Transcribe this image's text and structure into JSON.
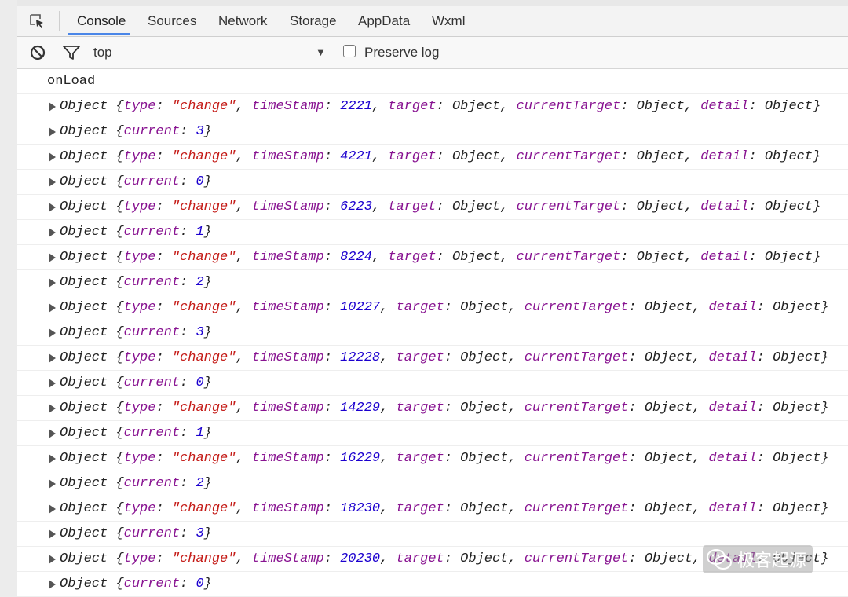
{
  "tabs": [
    "Console",
    "Sources",
    "Network",
    "Storage",
    "AppData",
    "Wxml"
  ],
  "toolbar": {
    "context": "top",
    "dropdown_arrow": "▼",
    "preserve_log": "Preserve log"
  },
  "log": {
    "first": "onLoad",
    "event_prefix": "Object {",
    "current_prefix": "Object {",
    "entries": [
      {
        "kind": "event",
        "timeStamp": "2221"
      },
      {
        "kind": "current",
        "current": "3"
      },
      {
        "kind": "event",
        "timeStamp": "4221"
      },
      {
        "kind": "current",
        "current": "0"
      },
      {
        "kind": "event",
        "timeStamp": "6223"
      },
      {
        "kind": "current",
        "current": "1"
      },
      {
        "kind": "event",
        "timeStamp": "8224"
      },
      {
        "kind": "current",
        "current": "2"
      },
      {
        "kind": "event",
        "timeStamp": "10227"
      },
      {
        "kind": "current",
        "current": "3"
      },
      {
        "kind": "event",
        "timeStamp": "12228"
      },
      {
        "kind": "current",
        "current": "0"
      },
      {
        "kind": "event",
        "timeStamp": "14229"
      },
      {
        "kind": "current",
        "current": "1"
      },
      {
        "kind": "event",
        "timeStamp": "16229"
      },
      {
        "kind": "current",
        "current": "2"
      },
      {
        "kind": "event",
        "timeStamp": "18230"
      },
      {
        "kind": "current",
        "current": "3"
      },
      {
        "kind": "event",
        "timeStamp": "20230"
      },
      {
        "kind": "current",
        "current": "0"
      }
    ],
    "keys": {
      "type": "type",
      "change": "\"change\"",
      "timeStamp": "timeStamp",
      "target": "target",
      "currentTarget": "currentTarget",
      "detail": "detail",
      "object": "Object",
      "current": "current"
    }
  },
  "watermark": {
    "text": "极客起源"
  },
  "icons": [
    "inspect-icon",
    "clear-console-icon",
    "filter-icon",
    "chevron-down-icon",
    "expand-arrow-icon",
    "wechat-icon"
  ]
}
